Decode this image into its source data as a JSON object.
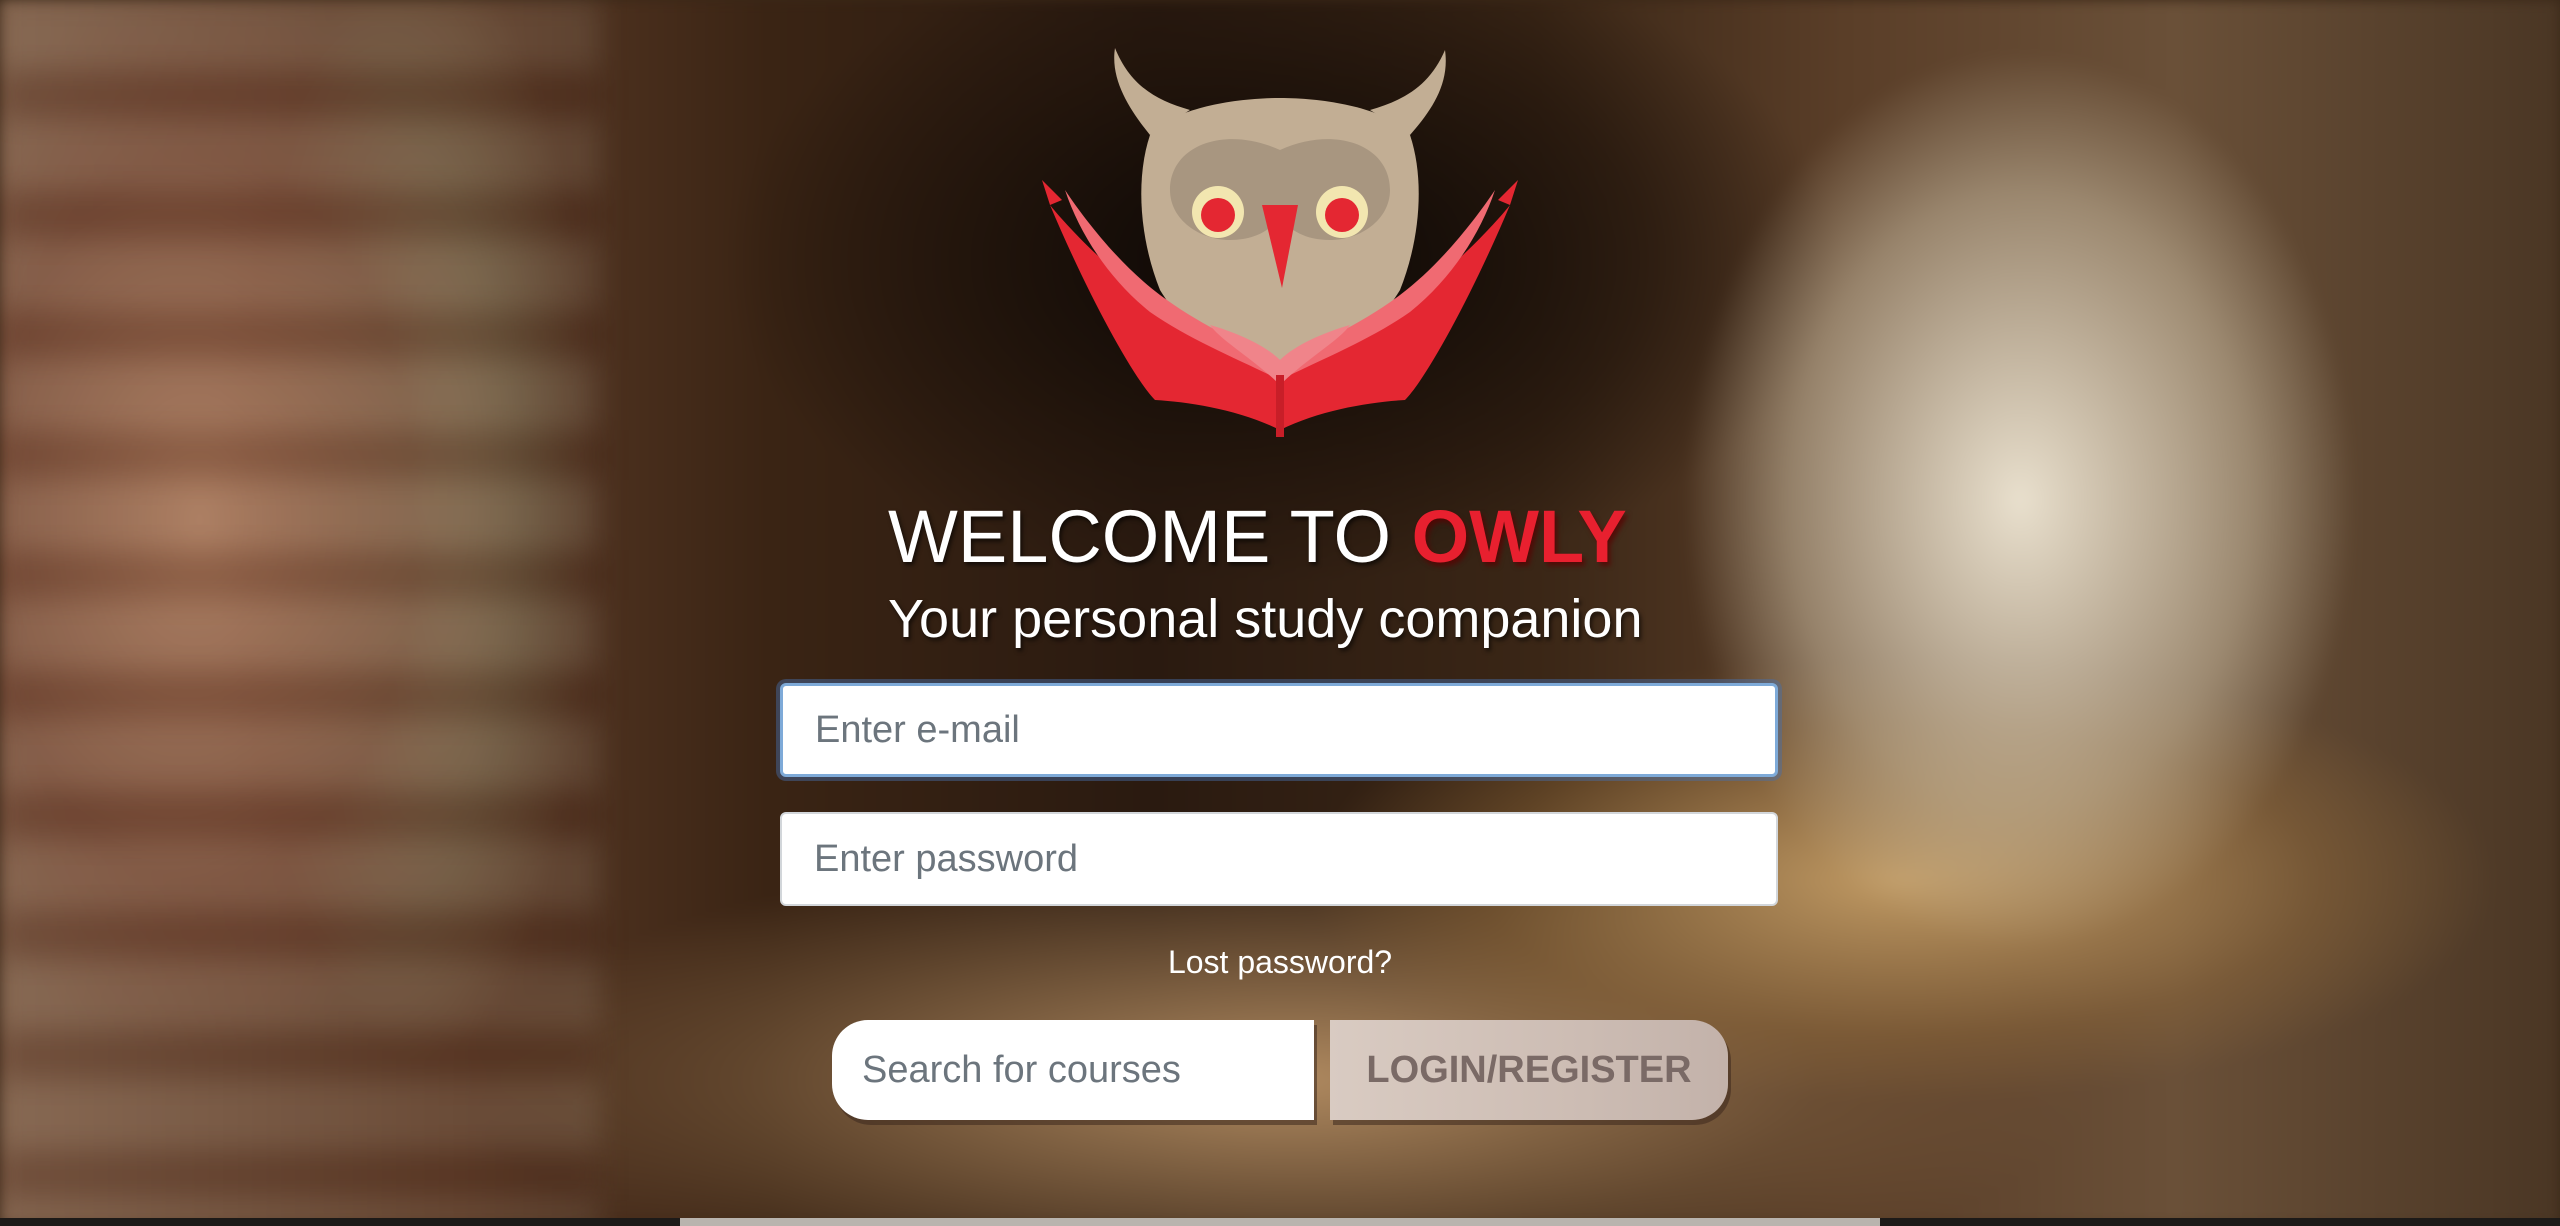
{
  "header": {
    "welcome_prefix": "WELCOME TO ",
    "brand_name": "OWLY",
    "subtitle": "Your personal study companion"
  },
  "form": {
    "email_placeholder": "Enter e-mail",
    "email_value": "",
    "password_placeholder": "Enter password",
    "password_value": "",
    "lost_password_label": "Lost password?"
  },
  "actions": {
    "search_placeholder": "Search for courses",
    "search_value": "",
    "login_register_label": "LOGIN/REGISTER"
  },
  "colors": {
    "brand_red": "#e8202f",
    "owl_body": "#c2ae94",
    "owl_face": "#a89680",
    "book_red": "#e42732",
    "input_focus_border": "#7eaad8"
  },
  "icons": {
    "logo": "owl-reading-book-logo"
  }
}
